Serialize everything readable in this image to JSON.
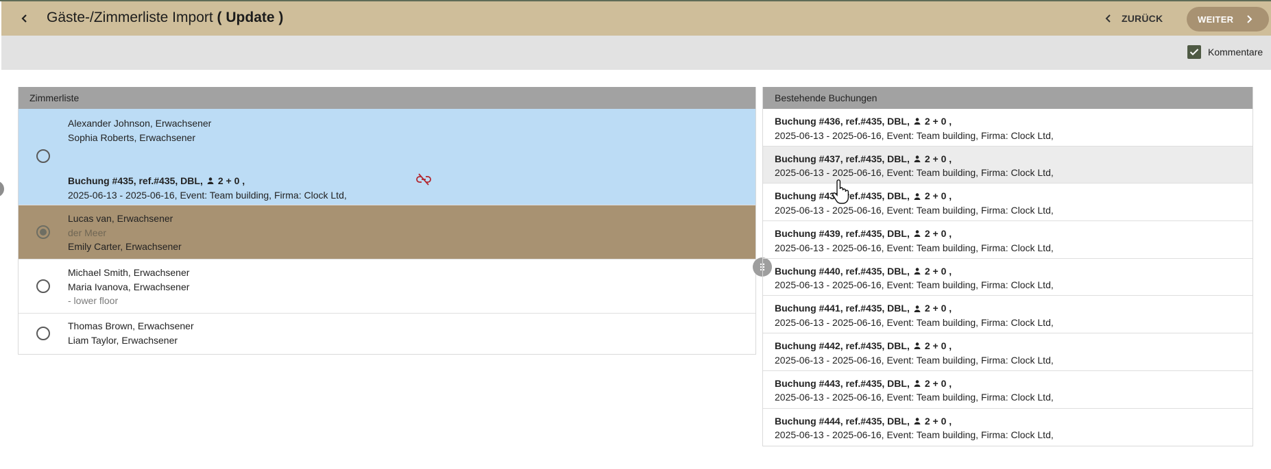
{
  "header": {
    "title": "Gäste-/Zimmerliste Import",
    "title_bold": "( Update )",
    "back_label": "ZURÜCK",
    "next_label": "WEITER"
  },
  "toolbar": {
    "comments_label": "Kommentare",
    "comments_checked": true
  },
  "room_list": {
    "header": "Zimmerliste",
    "rows": [
      {
        "guests": [
          "Alexander Johnson, Erwachsener",
          "Sophia Roberts, Erwachsener"
        ],
        "booking_title": "Buchung #435, ref.#435, DBL,",
        "booking_pax": "2 + 0 ,",
        "booking_details": "2025-06-13 - 2025-06-16, Event: Team building, Firma: Clock Ltd,",
        "state": "linked"
      },
      {
        "guests": [
          "Lucas van, Erwachsener",
          "der Meer",
          "Emily Carter, Erwachsener"
        ],
        "state": "selected"
      },
      {
        "guests": [
          "Michael Smith, Erwachsener",
          "Maria Ivanova, Erwachsener",
          "- lower floor"
        ],
        "state": "unselected"
      },
      {
        "guests": [
          "Thomas Brown, Erwachsener",
          "Liam Taylor, Erwachsener"
        ],
        "state": "unselected"
      }
    ]
  },
  "bookings": {
    "header": "Bestehende Buchungen",
    "items": [
      {
        "title": "Buchung #436, ref.#435, DBL,",
        "pax": "2 + 0 ,",
        "details": "2025-06-13 - 2025-06-16, Event: Team building, Firma: Clock Ltd,"
      },
      {
        "title": "Buchung #437, ref.#435, DBL,",
        "pax": "2 + 0 ,",
        "details": "2025-06-13 - 2025-06-16, Event: Team building, Firma: Clock Ltd,"
      },
      {
        "title": "Buchung #438, ref.#435, DBL,",
        "pax": "2 + 0 ,",
        "details": "2025-06-13 - 2025-06-16, Event: Team building, Firma: Clock Ltd,"
      },
      {
        "title": "Buchung #439, ref.#435, DBL,",
        "pax": "2 + 0 ,",
        "details": "2025-06-13 - 2025-06-16, Event: Team building, Firma: Clock Ltd,"
      },
      {
        "title": "Buchung #440, ref.#435, DBL,",
        "pax": "2 + 0 ,",
        "details": "2025-06-13 - 2025-06-16, Event: Team building, Firma: Clock Ltd,"
      },
      {
        "title": "Buchung #441, ref.#435, DBL,",
        "pax": "2 + 0 ,",
        "details": "2025-06-13 - 2025-06-16, Event: Team building, Firma: Clock Ltd,"
      },
      {
        "title": "Buchung #442, ref.#435, DBL,",
        "pax": "2 + 0 ,",
        "details": "2025-06-13 - 2025-06-16, Event: Team building, Firma: Clock Ltd,"
      },
      {
        "title": "Buchung #443, ref.#435, DBL,",
        "pax": "2 + 0 ,",
        "details": "2025-06-13 - 2025-06-16, Event: Team building, Firma: Clock Ltd,"
      },
      {
        "title": "Buchung #444, ref.#435, DBL,",
        "pax": "2 + 0 ,",
        "details": "2025-06-13 - 2025-06-16, Event: Team building, Firma: Clock Ltd,"
      }
    ]
  },
  "colors": {
    "header_bg": "#cfbe9a",
    "toolbar_bg": "#e2e2e2",
    "linked_row_bg": "#bcdcf5",
    "selected_row_bg": "#a89272",
    "next_button_bg": "#a89272",
    "unlink_icon": "#b3262e"
  },
  "icons": {
    "back": "chevron-left-icon",
    "next": "chevron-right-icon",
    "unlink": "link-off-icon",
    "person": "person-icon",
    "splitter": "drag-handle-icon",
    "checkbox": "checkmark-icon"
  }
}
